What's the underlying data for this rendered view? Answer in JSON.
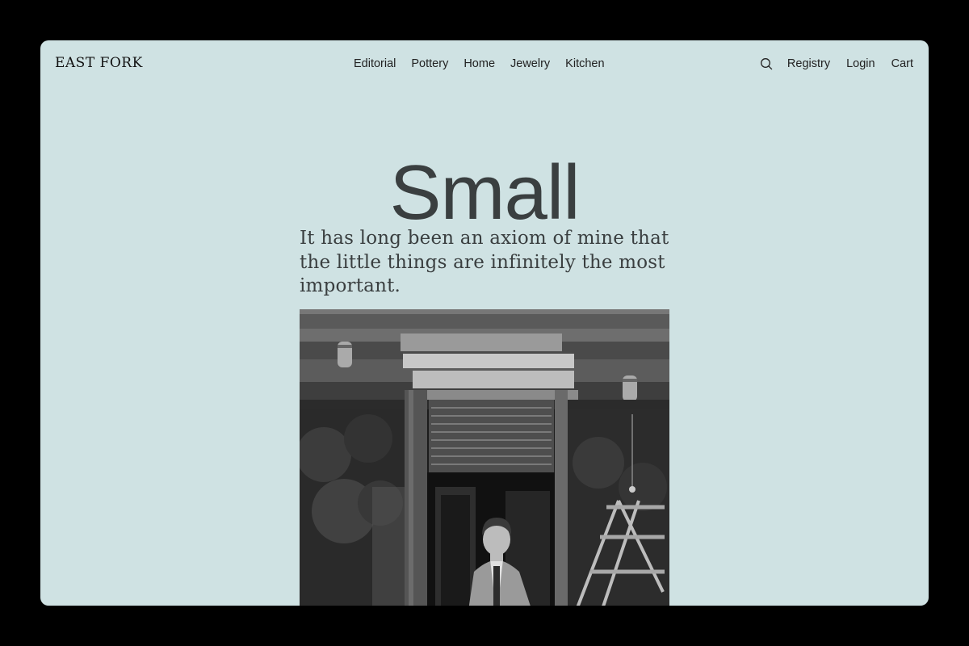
{
  "brand": {
    "logo_text": "EAST FORK"
  },
  "nav": {
    "center_items": [
      {
        "label": "Editorial"
      },
      {
        "label": "Pottery"
      },
      {
        "label": "Home"
      },
      {
        "label": "Jewelry"
      },
      {
        "label": "Kitchen"
      }
    ],
    "right_items": [
      {
        "label": "Registry"
      },
      {
        "label": "Login"
      },
      {
        "label": "Cart"
      }
    ],
    "search_icon": "search-icon"
  },
  "hero": {
    "title": "Small",
    "quote": "It has long been an axiom of mine that the little things are infinitely the most important."
  },
  "colors": {
    "page_background": "#cfe2e3",
    "text": "#3a3f40",
    "outer": "#000000"
  }
}
